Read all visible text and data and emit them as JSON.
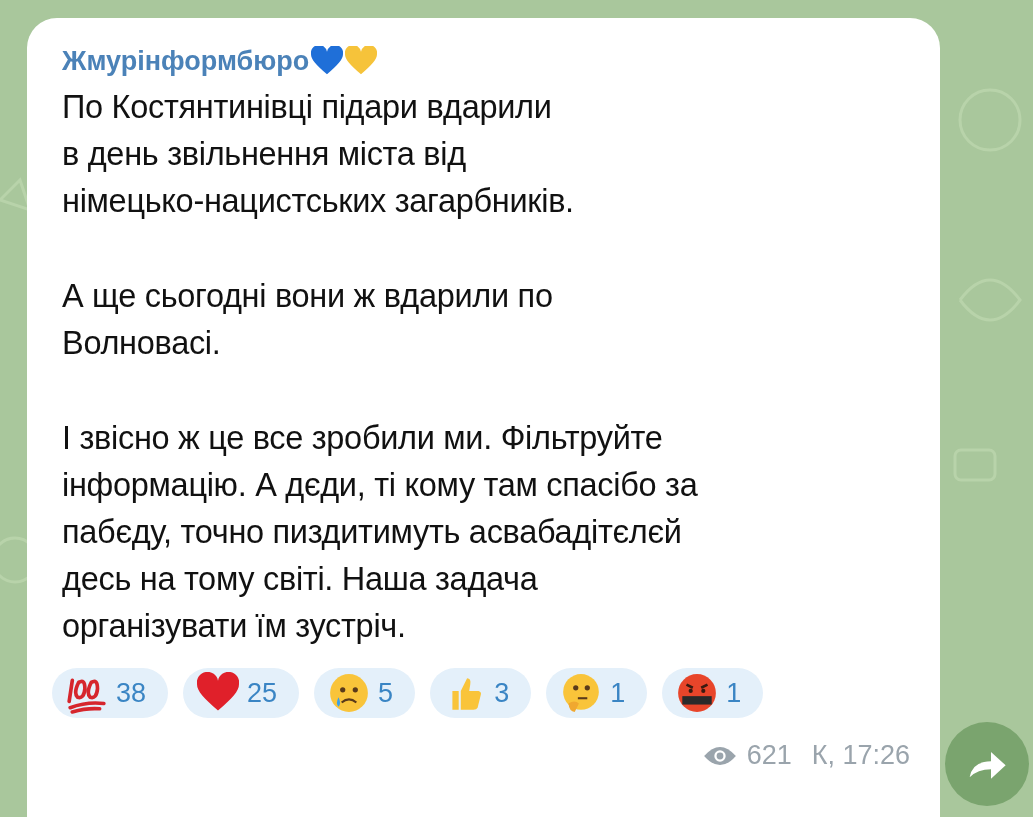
{
  "message": {
    "sender": "Жмурінформбюро",
    "paragraphs": [
      [
        "По Костянтинівці підари вдарили",
        "в день звільнення міста від",
        "німецько-нацистських загарбників."
      ],
      [
        "А ще сьогодні вони ж вдарили по",
        "Волновасі."
      ],
      [
        "І звісно ж це все зробили ми. Фільтруйте",
        "інформацію. А дєди, ті кому там спасібо за",
        "пабєду, точно пиздитимуть асвабадітєлєй",
        "десь на тому світі. Наша задача",
        "організувати їм зустріч."
      ]
    ],
    "reactions": [
      {
        "kind": "hundred",
        "count": "38"
      },
      {
        "kind": "heart",
        "count": "25"
      },
      {
        "kind": "cry",
        "count": "5"
      },
      {
        "kind": "thumbs",
        "count": "3"
      },
      {
        "kind": "think",
        "count": "1"
      },
      {
        "kind": "curse",
        "count": "1"
      }
    ],
    "views": "621",
    "signature": "К, 17:26"
  }
}
